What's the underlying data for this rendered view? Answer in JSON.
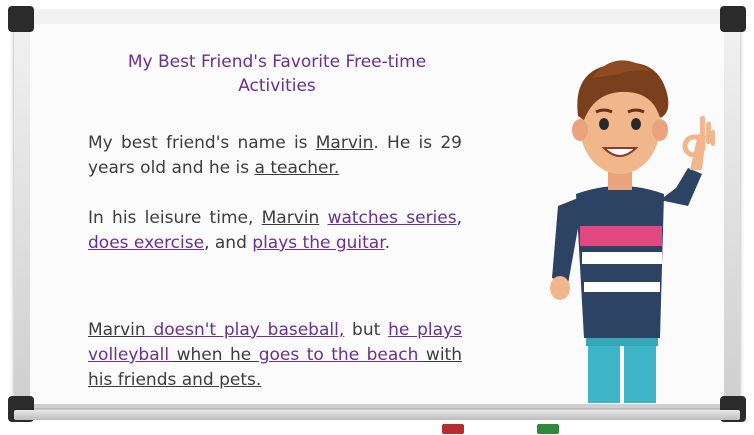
{
  "title": "My Best Friend's Favorite Free-time Activities",
  "paragraphs": [
    {
      "segments": [
        {
          "text": "My best friend's name is ",
          "style": "plain"
        },
        {
          "text": "Marvin",
          "style": "underline"
        },
        {
          "text": ". He is 29 years old and he is ",
          "style": "plain"
        },
        {
          "text": "a teacher.",
          "style": "underline"
        }
      ]
    },
    {
      "segments": [
        {
          "text": "In his leisure time, ",
          "style": "plain"
        },
        {
          "text": "Marvin",
          "style": "underline"
        },
        {
          "text": " ",
          "style": "plain"
        },
        {
          "text": "watches series",
          "style": "link"
        },
        {
          "text": ", ",
          "style": "plain"
        },
        {
          "text": "does exercise",
          "style": "link"
        },
        {
          "text": ", and ",
          "style": "plain"
        },
        {
          "text": "plays the guitar",
          "style": "link"
        },
        {
          "text": ".",
          "style": "plain"
        }
      ]
    },
    {
      "segments": [
        {
          "text": "Marvin",
          "style": "underline"
        },
        {
          "text": " doesn't play baseball,",
          "style": "link"
        },
        {
          "text": " but ",
          "style": "plain"
        },
        {
          "text": "he plays volleyball",
          "style": "link"
        },
        {
          "text": " when he ",
          "style": "underline"
        },
        {
          "text": "goes to the beach",
          "style": "link"
        },
        {
          "text": " with his friends and pets.",
          "style": "underline"
        }
      ]
    }
  ],
  "colors": {
    "accent": "#6a2f8f",
    "text": "#3d3d3d",
    "marker_red": "#b62d2d",
    "marker_green": "#2f8a3d"
  },
  "icons": {
    "illustration": "cartoon-man-ok-gesture"
  }
}
